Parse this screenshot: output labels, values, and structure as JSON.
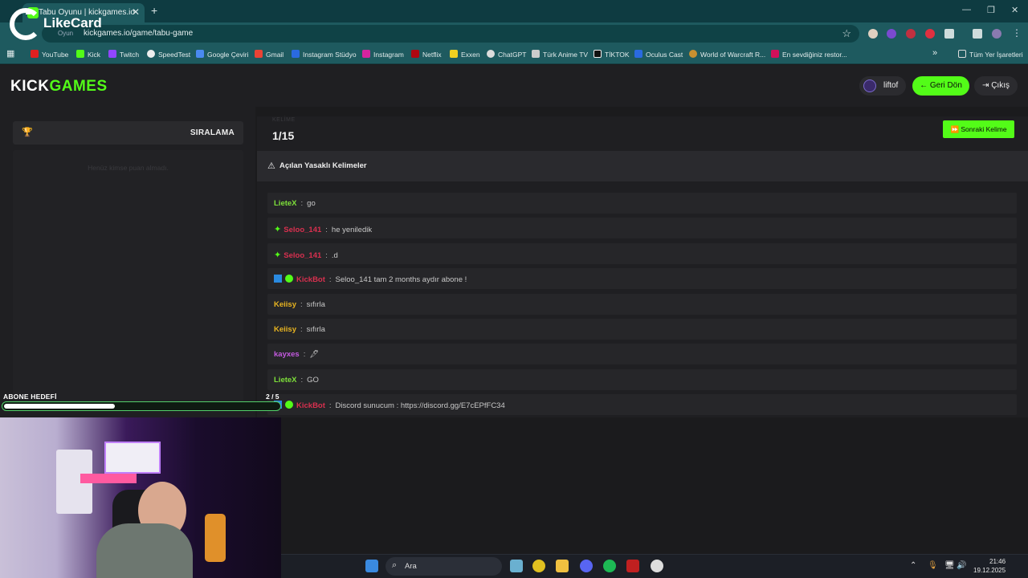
{
  "browser": {
    "tab_title": "Tabu Oyunu | kickgames.io",
    "url": "kickgames.io/game/tabu-game",
    "bookmarks": [
      "YouTube",
      "Kick",
      "Twitch",
      "SpeedTest",
      "Google Çeviri",
      "Gmail",
      "Instagram Stüdyo",
      "Instagram",
      "Netflix",
      "Exxen",
      "ChatGPT",
      "Türk Anime TV",
      "TİKTOK",
      "Oculus Cast",
      "World of Warcraft R...",
      "En sevdiğiniz restor..."
    ],
    "all_bookmarks": "Tüm Yer İşaretleri"
  },
  "overlay_brand": {
    "name": "LikeCard",
    "sub": "Oyun"
  },
  "app": {
    "logo_kick": "KICK",
    "logo_games": "GAMES",
    "username": "liftof",
    "back_label": "Geri Dön",
    "exit_label": "Çıkış"
  },
  "leaderboard": {
    "title": "SIRALAMA",
    "empty_text": "Henüz kimse puan almadı."
  },
  "game": {
    "round_label": "KELİME",
    "round": "1/15",
    "next_label": "Sonraki Kelime",
    "warn_label": "Açılan Yasaklı Kelimeler"
  },
  "chat": [
    {
      "user": "LieteX",
      "color": "#7ee03a",
      "text": "go",
      "badges": []
    },
    {
      "user": "Seloo_141",
      "color": "#d9304f",
      "text": "he yeniledik",
      "badges": [
        "spark"
      ]
    },
    {
      "user": "Seloo_141",
      "color": "#d9304f",
      "text": ".d",
      "badges": [
        "spark"
      ]
    },
    {
      "user": "KickBot",
      "color": "#d9304f",
      "text": "Seloo_141 tam 2 months aydır abone !",
      "badges": [
        "bot",
        "verified"
      ]
    },
    {
      "user": "Keiisy",
      "color": "#e8b420",
      "text": "sıfırla",
      "badges": []
    },
    {
      "user": "Keiisy",
      "color": "#e8b420",
      "text": "sıfırla",
      "badges": []
    },
    {
      "user": "kayxes",
      "color": "#c45ae0",
      "text": "🖋",
      "badges": []
    },
    {
      "user": "LieteX",
      "color": "#7ee03a",
      "text": "GO",
      "badges": []
    },
    {
      "user": "KickBot",
      "color": "#d9304f",
      "text": "Discord sunucum : https://discord.gg/E7cEPfFC34",
      "badges": [
        "bot",
        "verified"
      ]
    }
  ],
  "stream_overlay": {
    "sub_goal_label": "ABONE HEDEFİ",
    "sub_count": "2 / 5",
    "sub_progress": 0.4
  },
  "taskbar": {
    "search_label": "Ara",
    "time": "21:46",
    "date": "19.12.2025"
  },
  "colors": {
    "accent": "#53fc18",
    "bg": "#1b1b1d"
  }
}
